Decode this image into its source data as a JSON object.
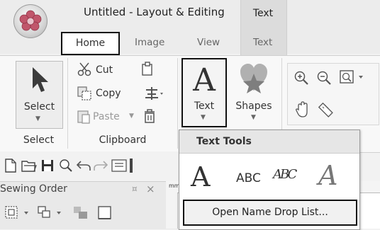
{
  "window": {
    "title": "Untitled - Layout & Editing",
    "contextual_tab": "Text"
  },
  "tabs": [
    {
      "label": "Home"
    },
    {
      "label": "Image"
    },
    {
      "label": "View"
    },
    {
      "label": "Text"
    }
  ],
  "ribbon": {
    "select": {
      "button_label": "Select",
      "group_label": "Select"
    },
    "clipboard": {
      "cut": "Cut",
      "copy": "Copy",
      "paste": "Paste",
      "group_label": "Clipboard"
    },
    "text_button": "Text",
    "shapes_button": "Shapes"
  },
  "text_tools_dropdown": {
    "header": "Text Tools",
    "items": [
      {
        "label": "A"
      },
      {
        "label": "ABC"
      },
      {
        "label": "ABC"
      },
      {
        "label": "A"
      }
    ],
    "open_name_drop_list": "Open Name Drop List..."
  },
  "sewing_order": {
    "title": "Sewing Order",
    "pin": "¤",
    "close": "×"
  },
  "ruler": {
    "unit": "mm"
  }
}
